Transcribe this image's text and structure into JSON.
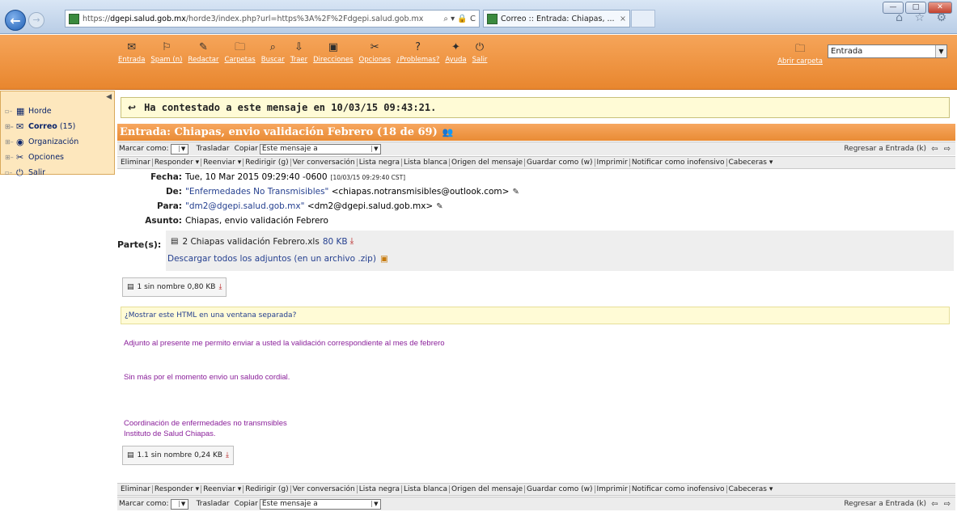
{
  "browser": {
    "url_prefix": "https://",
    "url_host": "dgepi.salud.gob.mx",
    "url_path": "/horde3/index.php?url=https%3A%2F%2Fdgepi.salud.gob.mx",
    "url_tools": "⌕ ▾ 🔒 C",
    "tab_title": "Correo :: Entrada: Chiapas, ...",
    "tab_close": "×",
    "right_icons": "⌂ ☆ ⚙"
  },
  "toolbar": {
    "items": [
      {
        "icon": "✉",
        "label": "Entrada"
      },
      {
        "icon": "⚐",
        "label": "Spam (n)"
      },
      {
        "icon": "✎",
        "label": "Redactar"
      },
      {
        "icon": "🗀",
        "label": "Carpetas"
      },
      {
        "icon": "⌕",
        "label": "Buscar"
      },
      {
        "icon": "⇩",
        "label": "Traer"
      },
      {
        "icon": "▣",
        "label": "Direcciones"
      },
      {
        "icon": "✂",
        "label": "Opciones"
      },
      {
        "icon": "?",
        "label": "¿Problemas?"
      },
      {
        "icon": "✦",
        "label": "Ayuda"
      },
      {
        "icon": "⏻",
        "label": "Salir"
      }
    ],
    "open_folder_label": "Abrir carpeta",
    "open_folder_icon": "🗀",
    "folder_value": "Entrada"
  },
  "sidebar": {
    "items": [
      {
        "icon": "▦",
        "label": "Horde",
        "count": ""
      },
      {
        "icon": "✉",
        "label": "Correo",
        "count": "(15)"
      },
      {
        "icon": "◉",
        "label": "Organización",
        "count": ""
      },
      {
        "icon": "✂",
        "label": "Opciones",
        "count": ""
      },
      {
        "icon": "⏻",
        "label": "Salir",
        "count": ""
      }
    ]
  },
  "message": {
    "replied_notice": "Ha contestado a este mensaje en 10/03/15 09:43:21.",
    "subject_header": "Entrada: Chiapas, envio validación Febrero (18 de 69)",
    "mark_as_label": "Marcar como:",
    "move_label": "Trasladar",
    "copy_label": "Copiar",
    "move_target": "Este mensaje a",
    "back_link": "Regresar a Entrada (k)",
    "arrows": "⇦ ⇨",
    "actions": [
      "Eliminar",
      "Responder ▾",
      "Reenviar ▾",
      "Redirigir (g)",
      "Ver conversación",
      "Lista negra",
      "Lista blanca",
      "Origen del mensaje",
      "Guardar como (w)",
      "Imprimir",
      "Notificar como inofensivo",
      "Cabeceras ▾"
    ],
    "headers": {
      "date_key": "Fecha:",
      "date_value": "Tue, 10 Mar 2015 09:29:40 -0600",
      "date_small": "[10/03/15 09:29:40 CST]",
      "from_key": "De:",
      "from_name": "\"Enfermedades No Transmisibles\"",
      "from_email": "<chiapas.notransmisibles@outlook.com>",
      "to_key": "Para:",
      "to_name": "\"dm2@dgepi.salud.gob.mx\"",
      "to_email": "<dm2@dgepi.salud.gob.mx>",
      "subject_key": "Asunto:",
      "subject_value": "Chiapas, envio validación Febrero"
    },
    "parts": {
      "label": "Parte(s):",
      "file": "2 Chiapas validación Febrero.xls",
      "size": "80 KB",
      "download_all": "Descargar todos los adjuntos (en un archivo .zip)"
    },
    "attachment_1": {
      "name": "1 sin nombre",
      "size": "0,80 KB"
    },
    "html_prompt": "¿Mostrar este HTML en una ventana separada?",
    "body_lines": [
      "Adjunto al presente  me permito enviar a usted la validación correspondiente al mes de febrero",
      "Sin más por el momento envio un saludo cordial.",
      "Coordinación de enfermedades no transmsibles",
      "Instituto de Salud Chiapas."
    ],
    "attachment_2": {
      "name": "1.1 sin nombre",
      "size": "0,24 KB"
    }
  }
}
